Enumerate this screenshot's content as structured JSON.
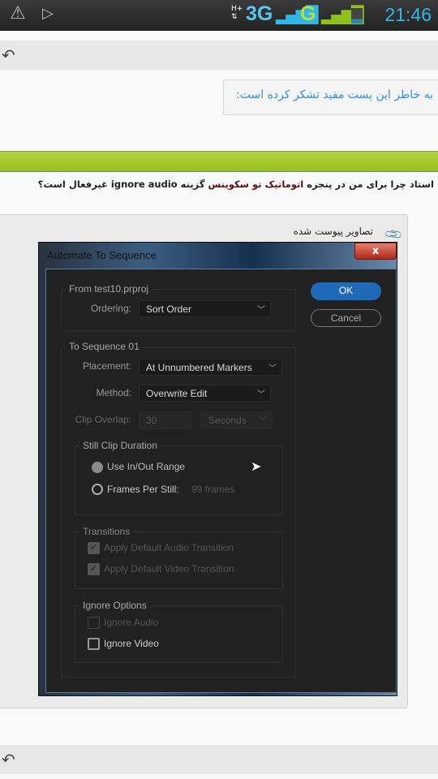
{
  "status_bar": {
    "time": "21:46",
    "network_1": "3G",
    "network_2": "G",
    "icons": [
      "warning-icon",
      "play-store-icon",
      "data-arrows-icon",
      "signal-icon",
      "battery-icon"
    ]
  },
  "thanks_text": "به خاطر این پست مفید تشکر کرده است:",
  "post": {
    "part1": "استاد چرا برای من در پنجره ",
    "part2": "اتوماتیک تو سکوینس",
    "part3": " گزینه ignore audio غیرفعال است؟"
  },
  "attachments_label": "تصاویر پیوست شده",
  "dialog": {
    "title": "Automate To Sequence",
    "close": "x",
    "ok": "OK",
    "cancel": "Cancel",
    "from_group": "From test10.prproj",
    "ordering_label": "Ordering:",
    "ordering_value": "Sort Order",
    "to_group": "To Sequence 01",
    "placement_label": "Placement:",
    "placement_value": "At Unnumbered Markers",
    "method_label": "Method:",
    "method_value": "Overwrite Edit",
    "clip_overlap_label": "Clip Overlap:",
    "clip_overlap_value": "30",
    "clip_overlap_unit": "Seconds",
    "still_group": "Still Clip Duration",
    "use_inout": "Use In/Out Range",
    "frames_per_still": "Frames Per Still:",
    "frames_value": "99 frames",
    "transitions_group": "Transitions",
    "audio_transition": "Apply Default Audio Transition",
    "video_transition": "Apply Default Video Transition",
    "ignore_group": "Ignore Options",
    "ignore_audio": "Ignore Audio",
    "ignore_video": "Ignore Video"
  },
  "colors": {
    "accent_blue": "#1f6ab8",
    "green_bar": "#a6c82c",
    "link_blue": "#2d8ee0"
  }
}
